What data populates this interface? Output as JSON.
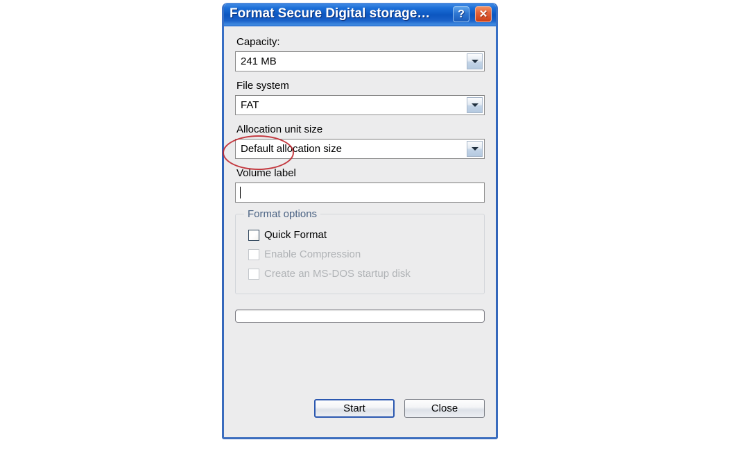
{
  "window": {
    "title": "Format Secure Digital storage…",
    "help_button_label": "?",
    "close_button_label": "✕",
    "help_icon_name": "question-mark-icon",
    "close_icon_name": "close-icon"
  },
  "fields": {
    "capacity": {
      "label": "Capacity:",
      "value": "241 MB"
    },
    "file_system": {
      "label": "File system",
      "value": "FAT"
    },
    "allocation_unit_size": {
      "label": "Allocation unit size",
      "value": "Default allocation size"
    },
    "volume_label": {
      "label": "Volume label",
      "value": "",
      "placeholder": ""
    }
  },
  "format_options": {
    "legend": "Format options",
    "items": [
      {
        "label": "Quick Format",
        "checked": false,
        "disabled": false
      },
      {
        "label": "Enable Compression",
        "checked": false,
        "disabled": true
      },
      {
        "label": "Create an MS-DOS startup disk",
        "checked": false,
        "disabled": true
      }
    ]
  },
  "progress": {
    "value": 0,
    "label": ""
  },
  "buttons": {
    "start": "Start",
    "close": "Close"
  },
  "annotation": {
    "shape": "ellipse",
    "color": "#c0272d",
    "target": "FAT"
  },
  "colors": {
    "titlebar_blue": "#0c56c0",
    "dialog_face": "#ececed",
    "legend_blue": "#4a6283",
    "close_red": "#cc3f17",
    "default_button_border": "#2b58b0",
    "annotation_red": "#c0272d"
  }
}
